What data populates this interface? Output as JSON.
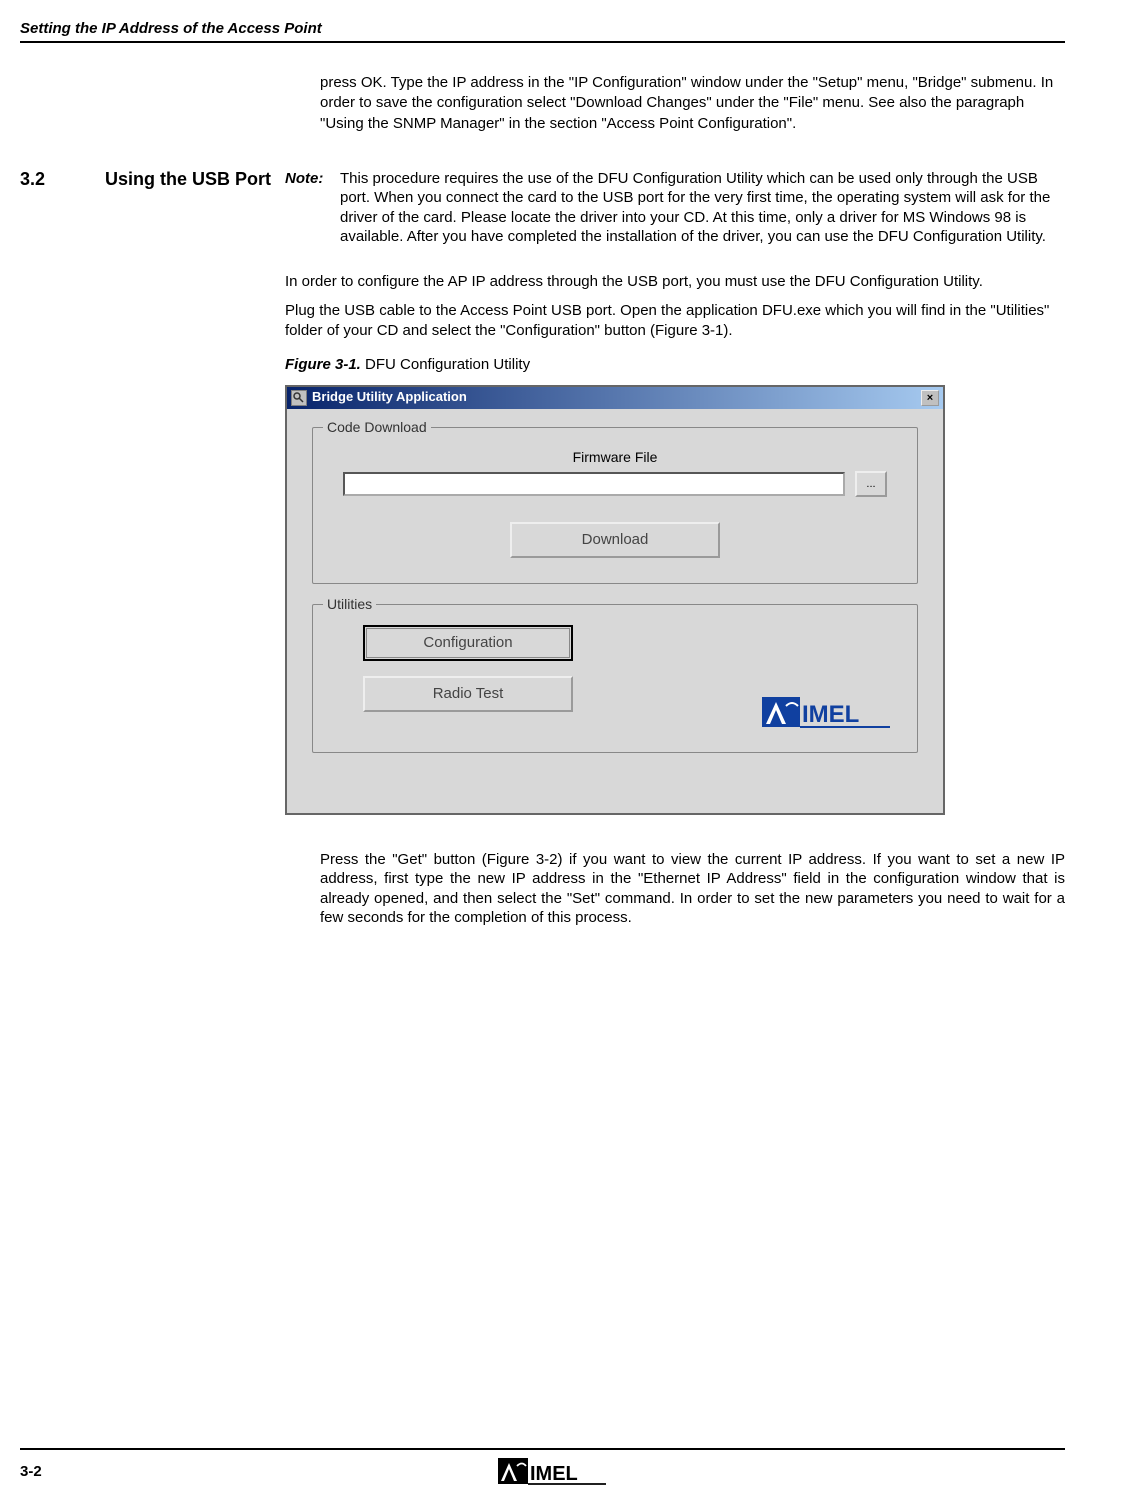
{
  "header": {
    "title": "Setting the IP Address of the Access Point"
  },
  "intro": {
    "text": "press OK. Type the IP address in the \"IP Configuration\" window under the \"Setup\" menu, \"Bridge\" submenu. In order to save the configuration select \"Download Changes\" under the \"File\" menu. See also the paragraph \"Using the SNMP Manager\" in the section \"Access Point Configuration\"."
  },
  "section": {
    "number": "3.2",
    "title": "Using the USB Port",
    "note_label": "Note:",
    "note_text": "This procedure requires the use of the DFU Configuration Utility which can be used only through the USB port. When you connect the card to the USB port for the very first time, the operating system will ask for the driver of the card. Please locate the driver into your CD. At this time, only a driver for MS Windows 98 is available. After you have completed the installation of the driver, you can use the DFU Configuration Utility.",
    "body_p1": "In order to configure the AP IP address through the USB port, you must use the DFU Configuration Utility.",
    "body_p2": "Plug the USB cable to the Access Point USB port. Open the application DFU.exe which you will find in the \"Utilities\" folder of your CD and select the \"Configuration\" button (Figure 3-1).",
    "figure_label": "Figure 3-1.",
    "figure_title": "  DFU Configuration Utility"
  },
  "screenshot": {
    "window_title": "Bridge Utility Application",
    "code_download": {
      "legend": "Code Download",
      "field_label": "Firmware File",
      "browse": "...",
      "download_btn": "Download"
    },
    "utilities": {
      "legend": "Utilities",
      "config_btn": "Configuration",
      "radio_btn": "Radio Test"
    },
    "close": "×"
  },
  "footer_paragraph": "Press the \"Get\" button (Figure 3-2) if you want to view the current IP address. If you want to set a new IP address, first type the new IP address in the \"Ethernet IP Address\" field in the configuration window that is already opened, and then select the \"Set\" command. In order to set the new parameters you need to wait for a few seconds for the completion of this process.",
  "page_footer": {
    "page_num": "3-2"
  }
}
